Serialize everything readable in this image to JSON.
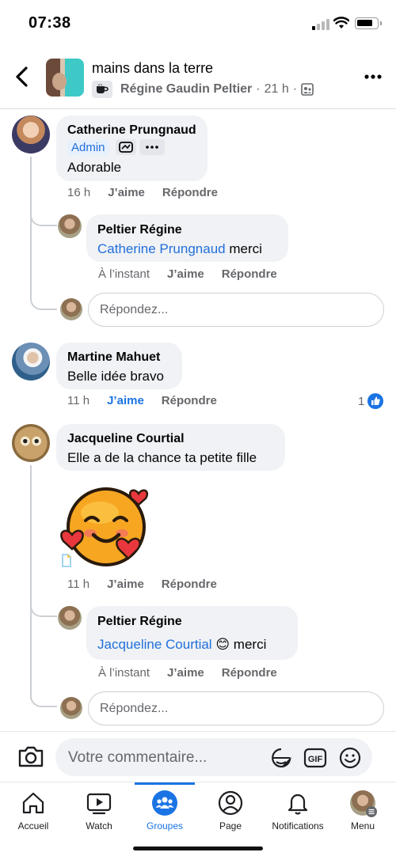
{
  "status_bar": {
    "time": "07:38"
  },
  "header": {
    "group_name": "mains dans la terre",
    "poster_name": "Régine Gaudin Peltier",
    "separator": "·",
    "post_time": "21 h"
  },
  "comments": [
    {
      "author": "Catherine Prungnaud",
      "badge": "Admin",
      "text": "Adorable",
      "time": "16 h",
      "like_label": "J’aime",
      "reply_label": "Répondre",
      "replies": [
        {
          "author": "Peltier Régine",
          "mention": "Catherine Prungnaud",
          "text": " merci",
          "time": "À l’instant",
          "like_label": "J’aime",
          "reply_label": "Répondre"
        }
      ],
      "reply_placeholder": "Répondez..."
    },
    {
      "author": "Martine Mahuet",
      "text": "Belle idée bravo",
      "time": "11 h",
      "like_label": "J’aime",
      "liked": true,
      "reply_label": "Répondre",
      "reaction_count": "1"
    },
    {
      "author": "Jacqueline Courtial",
      "text": "Elle a de la chance ta petite fille",
      "sticker": "smiling-face-with-hearts-sticker",
      "time": "11 h",
      "like_label": "J’aime",
      "reply_label": "Répondre",
      "replies": [
        {
          "author": "Peltier Régine",
          "mention": "Jacqueline Courtial",
          "emoji": "😊",
          "text": " merci",
          "time": "À l’instant",
          "like_label": "J’aime",
          "reply_label": "Répondre"
        }
      ],
      "reply_placeholder": "Répondez..."
    }
  ],
  "composer": {
    "placeholder": "Votre commentaire..."
  },
  "tabs": [
    {
      "label": "Accueil",
      "icon": "home-icon"
    },
    {
      "label": "Watch",
      "icon": "watch-icon"
    },
    {
      "label": "Groupes",
      "icon": "groups-icon",
      "active": true
    },
    {
      "label": "Page",
      "icon": "page-icon"
    },
    {
      "label": "Notifications",
      "icon": "bell-icon"
    },
    {
      "label": "Menu",
      "icon": "menu-avatar"
    }
  ],
  "colors": {
    "accent": "#1b74e4",
    "mention": "#216fdb",
    "bubble": "#f0f2f5",
    "secondary_text": "#65676b"
  }
}
